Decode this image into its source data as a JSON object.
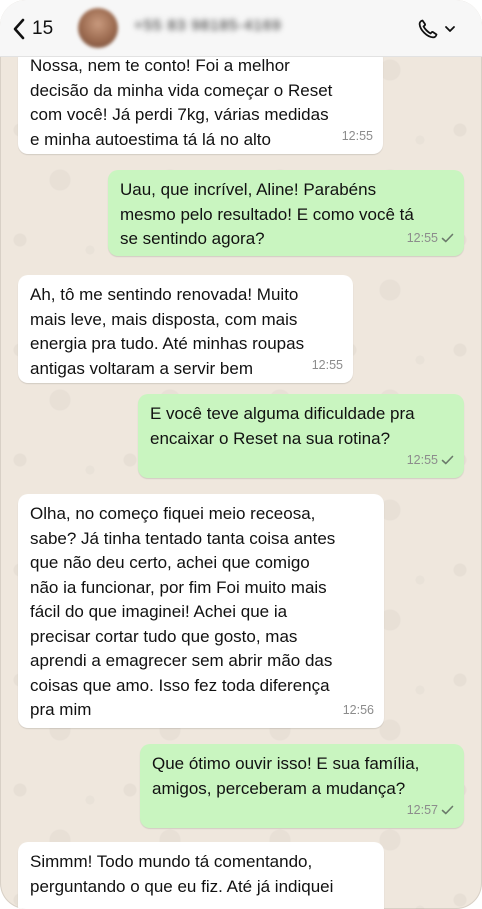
{
  "header": {
    "back_count": "15",
    "contact_name": "+55 83 98185-4169"
  },
  "messages": [
    {
      "text": "Nossa, nem te conto! Foi a melhor\ndecisão da minha vida começar o Reset\ncom você! Já perdi 7kg, várias medidas\ne minha autoestima tá lá no alto",
      "time": "12:55",
      "direction": "incoming"
    },
    {
      "text": "Uau, que incrível, Aline! Parabéns\nmesmo pelo resultado! E como você tá\nse sentindo agora?",
      "time": "12:55",
      "direction": "outgoing"
    },
    {
      "text": "Ah, tô me sentindo renovada! Muito\nmais leve, mais disposta, com mais\nenergia pra tudo. Até minhas roupas\nantigas voltaram a servir bem",
      "time": "12:55",
      "direction": "incoming"
    },
    {
      "text": "E você teve alguma dificuldade pra\nencaixar o Reset na sua rotina?",
      "time": "12:55",
      "direction": "outgoing"
    },
    {
      "text": "Olha, no começo fiquei meio receosa,\nsabe? Já tinha tentado tanta coisa antes\nque não deu certo, achei que comigo\nnão ia funcionar, por fim  Foi muito mais\nfácil do que imaginei! Achei que ia\nprecisar cortar tudo que gosto, mas\naprendi a emagrecer sem abrir mão das\ncoisas que amo. Isso fez toda diferença\npra mim",
      "time": "12:56",
      "direction": "incoming"
    },
    {
      "text": "Que ótimo ouvir isso! E sua família,\namigos, perceberam a mudança?",
      "time": "12:57",
      "direction": "outgoing"
    },
    {
      "text": "Simmm! Todo mundo tá comentando,\nperguntando o que eu fiz. Até já indiquei",
      "time": "",
      "direction": "incoming"
    }
  ]
}
